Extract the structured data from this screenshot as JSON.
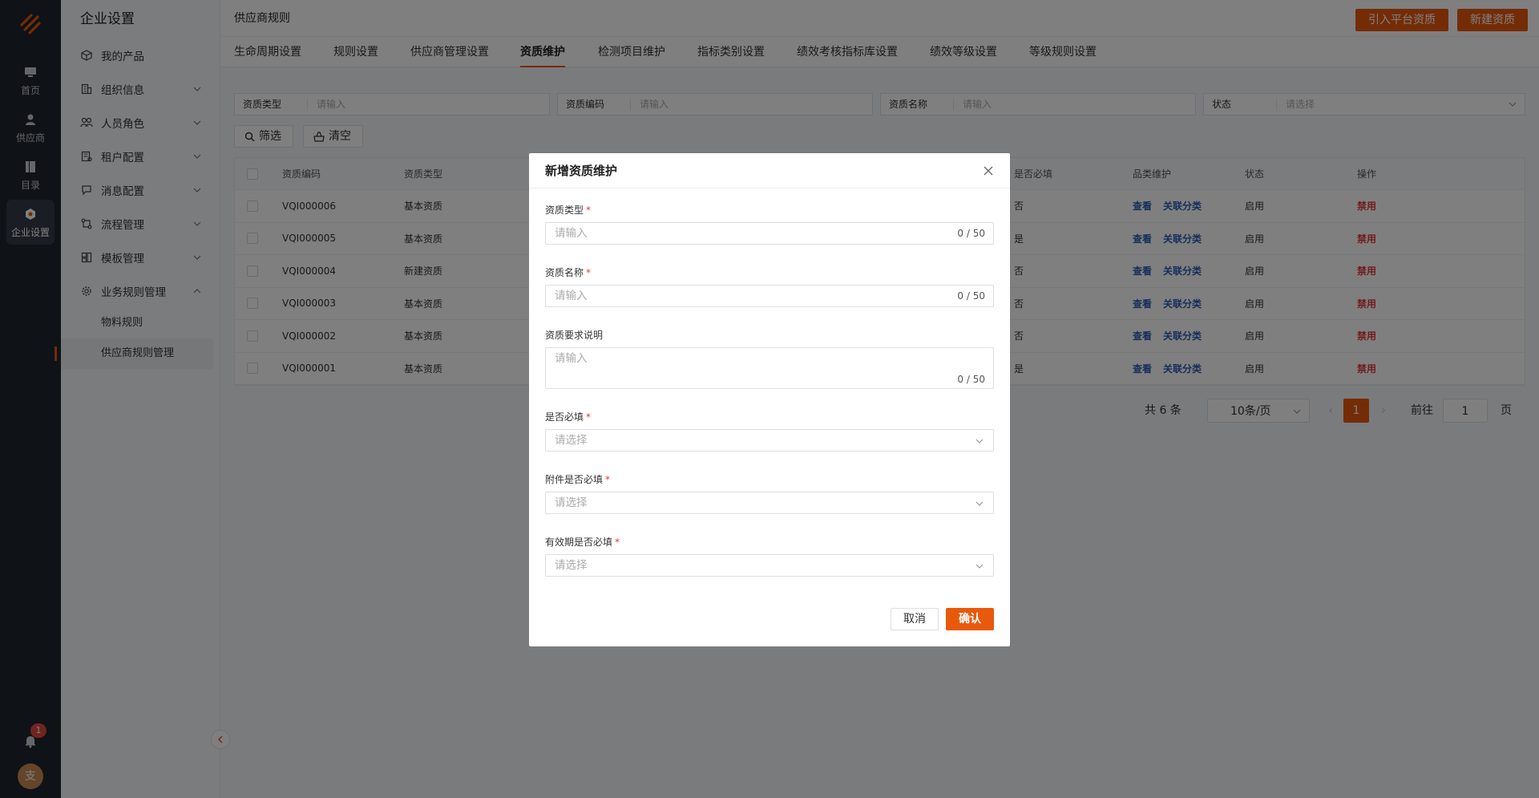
{
  "colors": {
    "accent": "#e8590c",
    "link": "#2b5fb4",
    "danger": "#e23b3b",
    "rail": "#1f242c"
  },
  "rail": {
    "items": [
      {
        "label": "首页",
        "icon": "monitor-icon"
      },
      {
        "label": "供应商",
        "icon": "user-icon"
      },
      {
        "label": "目录",
        "icon": "catalog-icon"
      },
      {
        "label": "企业设置",
        "icon": "hexagon-settings-icon"
      }
    ],
    "notification_count": "1",
    "avatar_text": "支"
  },
  "subnav": {
    "title": "企业设置",
    "items": [
      {
        "label": "我的产品",
        "icon": "cube-icon"
      },
      {
        "label": "组织信息",
        "icon": "building-icon"
      },
      {
        "label": "人员角色",
        "icon": "people-icon"
      },
      {
        "label": "租户配置",
        "icon": "tenant-icon"
      },
      {
        "label": "消息配置",
        "icon": "message-icon"
      },
      {
        "label": "流程管理",
        "icon": "flow-icon"
      },
      {
        "label": "模板管理",
        "icon": "template-icon"
      },
      {
        "label": "业务规则管理",
        "icon": "gear-icon"
      }
    ],
    "children": [
      {
        "label": "物料规则"
      },
      {
        "label": "供应商规则管理"
      }
    ]
  },
  "header": {
    "title": "供应商规则",
    "import_button": "引入平台资质",
    "new_button": "新建资质"
  },
  "tabs": [
    "生命周期设置",
    "规则设置",
    "供应商管理设置",
    "资质维护",
    "检测项目维护",
    "指标类别设置",
    "绩效考核指标库设置",
    "绩效等级设置",
    "等级规则设置"
  ],
  "filters": [
    {
      "label": "资质类型",
      "placeholder": "请输入"
    },
    {
      "label": "资质编码",
      "placeholder": "请输入"
    },
    {
      "label": "资质名称",
      "placeholder": "请输入"
    },
    {
      "label": "状态",
      "placeholder": "请选择"
    }
  ],
  "filter_buttons": {
    "filter": "筛选",
    "clear": "清空"
  },
  "table": {
    "columns": {
      "code": "资质编码",
      "type": "资质类型",
      "required": "是否必填",
      "category": "品类维护",
      "status": "状态",
      "action": "操作"
    },
    "rows": [
      {
        "code": "VQI000006",
        "type": "基本资质",
        "required": "否",
        "view": "查看",
        "link": "关联分类",
        "status": "启用",
        "action": "禁用"
      },
      {
        "code": "VQI000005",
        "type": "基本资质",
        "required": "是",
        "view": "查看",
        "link": "关联分类",
        "status": "启用",
        "action": "禁用"
      },
      {
        "code": "VQI000004",
        "type": "新建资质",
        "required": "否",
        "view": "查看",
        "link": "关联分类",
        "status": "启用",
        "action": "禁用"
      },
      {
        "code": "VQI000003",
        "type": "基本资质",
        "required": "否",
        "view": "查看",
        "link": "关联分类",
        "status": "启用",
        "action": "禁用"
      },
      {
        "code": "VQI000002",
        "type": "基本资质",
        "required": "否",
        "view": "查看",
        "link": "关联分类",
        "status": "启用",
        "action": "禁用"
      },
      {
        "code": "VQI000001",
        "type": "基本资质",
        "required": "是",
        "view": "查看",
        "link": "关联分类",
        "status": "启用",
        "action": "禁用"
      }
    ]
  },
  "pagination": {
    "total": "共 6 条",
    "page_size": "10条/页",
    "current_page": "1",
    "goto_label": "前往",
    "goto_value": "1",
    "page_unit": "页"
  },
  "modal": {
    "title": "新增资质维护",
    "fields": [
      {
        "label": "资质类型",
        "placeholder": "请输入",
        "counter": "0 / 50"
      },
      {
        "label": "资质名称",
        "placeholder": "请输入",
        "counter": "0 / 50"
      },
      {
        "label": "资质要求说明",
        "placeholder": "请输入",
        "counter": "0 / 50"
      },
      {
        "label": "是否必填",
        "placeholder": "请选择"
      },
      {
        "label": "附件是否必填",
        "placeholder": "请选择"
      },
      {
        "label": "有效期是否必填",
        "placeholder": "请选择"
      }
    ],
    "required_mark": "*",
    "cancel": "取消",
    "confirm": "确认"
  }
}
